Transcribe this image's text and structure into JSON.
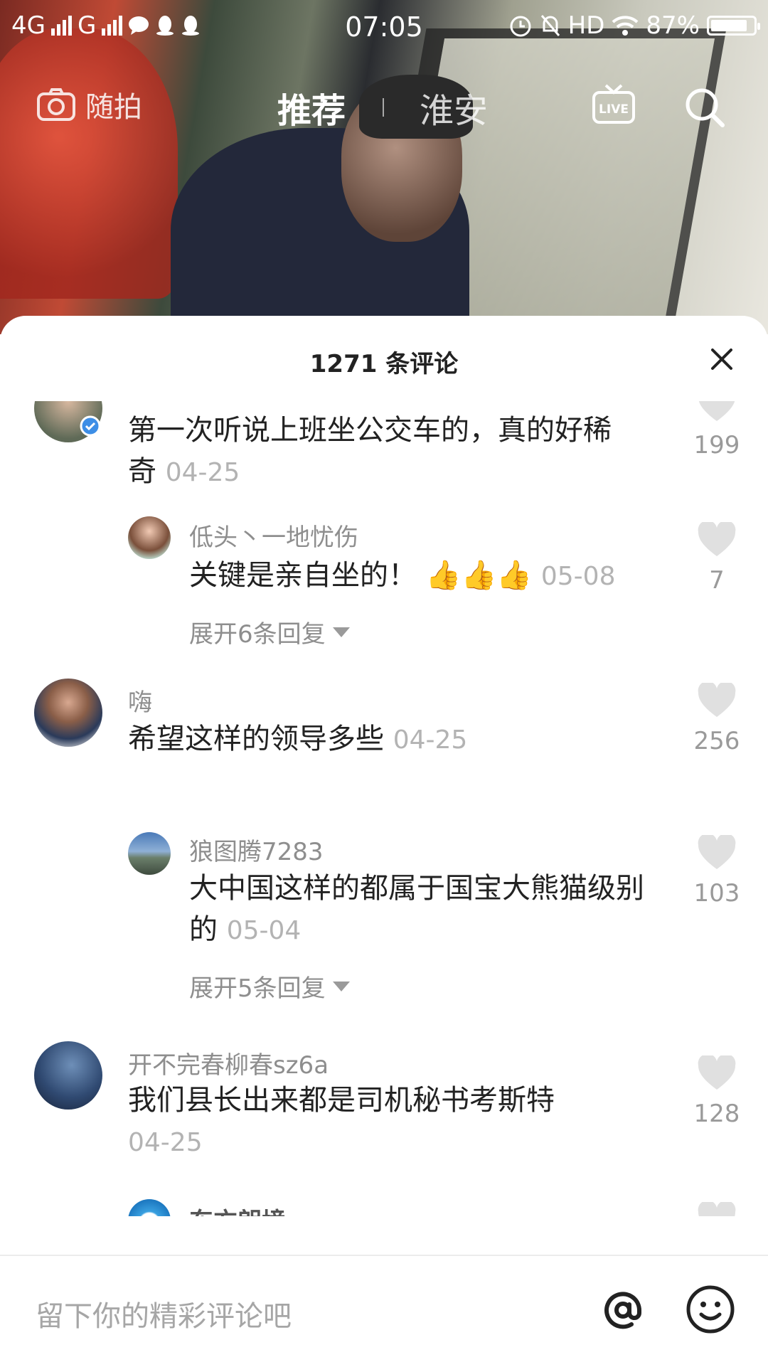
{
  "status_bar": {
    "network_1": "4G",
    "network_2": "G",
    "time": "07:05",
    "hd": "HD",
    "battery": "87%",
    "battery_level": 0.87
  },
  "top_nav": {
    "camera_label": "随拍",
    "tab_active": "推荐",
    "tab_local": "淮安",
    "live_label": "LIVE"
  },
  "comments_sheet": {
    "title": "1271 条评论",
    "comments": [
      {
        "text": "第一次听说上班坐公交车的，真的好稀奇",
        "date": "04-25",
        "likes": "199",
        "reply": {
          "username": "低头丶一地忧伤",
          "text": "关键是亲自坐的！",
          "emoji": "👍👍👍",
          "date": "05-08",
          "likes": "7"
        },
        "expand": "展开6条回复"
      },
      {
        "username": "嗨",
        "text": "希望这样的领导多些",
        "date": "04-25",
        "likes": "256",
        "reply": {
          "username": "狼图腾7283",
          "text": "大中国这样的都属于国宝大熊猫级别的",
          "date": "05-04",
          "likes": "103"
        },
        "expand": "展开5条回复"
      },
      {
        "username": "开不完春柳春sz6a",
        "text": "我们县长出来都是司机秘书考斯特",
        "date": "04-25",
        "likes": "128"
      },
      {
        "username": "东方朗境"
      }
    ]
  },
  "input_bar": {
    "placeholder": "留下你的精彩评论吧"
  },
  "colors": {
    "text_primary": "#222222",
    "text_secondary": "#8e8e8e",
    "date_gray": "#b3b3b3",
    "heart_gray": "#e0e0e0"
  }
}
